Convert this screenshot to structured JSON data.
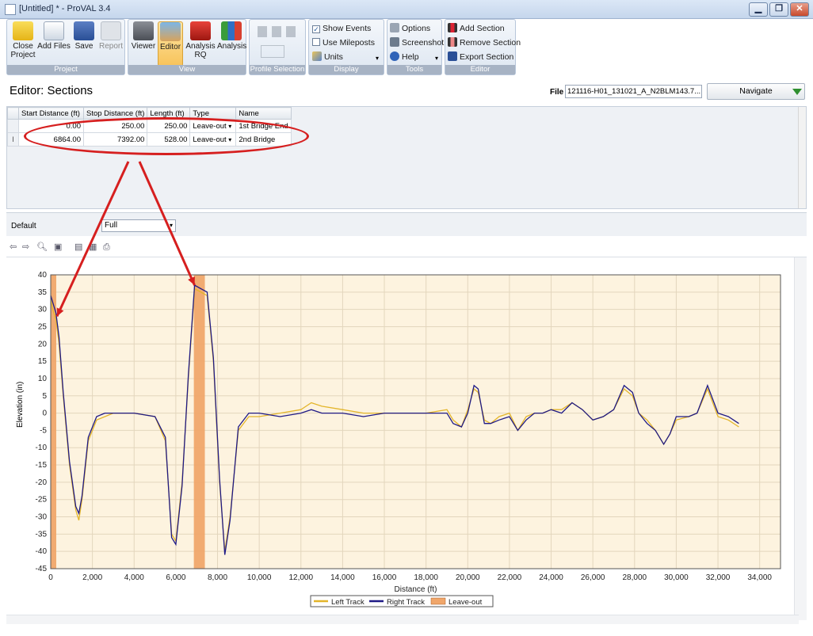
{
  "window": {
    "title": "[Untitled] * - ProVAL 3.4",
    "buttons": [
      "▁",
      "❐",
      "✕"
    ]
  },
  "ribbon": {
    "groups": {
      "project": "Project",
      "view": "View",
      "profile_selection": "Profile Selection",
      "display": "Display",
      "tools": "Tools",
      "editor": "Editor"
    },
    "buttons": {
      "close_project": "Close Project",
      "add_files": "Add Files",
      "save": "Save",
      "report": "Report",
      "viewer": "Viewer",
      "editor": "Editor",
      "analysis_rq": "Analysis RQ",
      "analysis": "Analysis"
    },
    "display": {
      "show_events": "Show Events",
      "use_mileposts": "Use Mileposts",
      "units": "Units"
    },
    "tools": {
      "options": "Options",
      "screenshot": "Screenshot",
      "help": "Help"
    },
    "editor": {
      "add_section": "Add Section",
      "remove_section": "Remove Section",
      "export_section": "Export Section"
    }
  },
  "editor": {
    "title": "Editor: Sections",
    "file_label": "File",
    "file_value": "121116-H01_131021_A_N2BLM143.7...",
    "navigate": "Navigate"
  },
  "sections_table": {
    "columns": [
      "Start Distance (ft)",
      "Stop Distance (ft)",
      "Length (ft)",
      "Type",
      "Name"
    ],
    "rows": [
      {
        "start": "0.00",
        "stop": "250.00",
        "length": "250.00",
        "type": "Leave-out",
        "name": "1st Bridge End"
      },
      {
        "start": "6864.00",
        "stop": "7392.00",
        "length": "528.00",
        "type": "Leave-out",
        "name": "2nd Bridge"
      }
    ],
    "row_marker": "I"
  },
  "view_bar": {
    "default_label": "Default",
    "zoom_value": "Full"
  },
  "colors": {
    "left_track": "#e3b52a",
    "right_track": "#1f1a86",
    "leave_out": "#f0a66a",
    "plot_bg": "#fdf3df",
    "annotation": "#d61f1f"
  },
  "chart_data": {
    "type": "line",
    "xlabel": "Distance (ft)",
    "ylabel": "Elevation (in)",
    "xlim": [
      0,
      35000
    ],
    "ylim": [
      -45,
      40
    ],
    "x_ticks": [
      0,
      2000,
      4000,
      6000,
      8000,
      10000,
      12000,
      14000,
      16000,
      18000,
      20000,
      22000,
      24000,
      26000,
      28000,
      30000,
      32000,
      34000
    ],
    "x_tick_labels": [
      "0",
      "2,000",
      "4,000",
      "6,000",
      "8,000",
      "10,000",
      "12,000",
      "14,000",
      "16,000",
      "18,000",
      "20,000",
      "22,000",
      "24,000",
      "26,000",
      "28,000",
      "30,000",
      "32,000",
      "34,000"
    ],
    "y_ticks": [
      40,
      35,
      30,
      25,
      20,
      15,
      10,
      5,
      0,
      -5,
      -10,
      -15,
      -20,
      -25,
      -30,
      -35,
      -40,
      -45
    ],
    "grid": true,
    "legend_position": "bottom",
    "series": [
      {
        "name": "Left Track",
        "x": [
          0,
          100,
          250,
          400,
          600,
          900,
          1200,
          1350,
          1500,
          1800,
          2200,
          2600,
          3000,
          4000,
          5000,
          5500,
          5800,
          6000,
          6300,
          6600,
          6900,
          7200,
          7500,
          7800,
          8100,
          8350,
          8600,
          9000,
          9500,
          10000,
          11000,
          12000,
          12500,
          13000,
          14000,
          15000,
          16000,
          17000,
          18000,
          19000,
          19300,
          19700,
          20000,
          20300,
          20500,
          20800,
          21100,
          21500,
          22000,
          22400,
          22800,
          23200,
          23600,
          24000,
          24500,
          25000,
          25500,
          26000,
          26500,
          27000,
          27500,
          27900,
          28200,
          28600,
          29000,
          29400,
          29700,
          30000,
          30600,
          31000,
          31500,
          32000,
          32500,
          33000
        ],
        "y": [
          33,
          30,
          27,
          20,
          5,
          -15,
          -28,
          -31,
          -25,
          -8,
          -2,
          -1,
          0,
          0,
          -1,
          -8,
          -35,
          -37,
          -20,
          10,
          36,
          35,
          34,
          15,
          -20,
          -40,
          -30,
          -5,
          -1,
          -1,
          0,
          1,
          3,
          2,
          1,
          0,
          0,
          0,
          0,
          1,
          -2,
          -4,
          1,
          7,
          6,
          -2,
          -3,
          -1,
          0,
          -5,
          -1,
          0,
          0,
          1,
          1,
          3,
          1,
          -2,
          -1,
          1,
          7,
          5,
          0,
          -2,
          -5,
          -9,
          -6,
          -2,
          -1,
          0,
          7,
          -1,
          -2,
          -4
        ]
      },
      {
        "name": "Right Track",
        "x": [
          0,
          100,
          250,
          400,
          600,
          900,
          1200,
          1350,
          1500,
          1800,
          2200,
          2600,
          3000,
          4000,
          5000,
          5500,
          5800,
          6000,
          6300,
          6600,
          6900,
          7200,
          7500,
          7800,
          8100,
          8350,
          8600,
          9000,
          9500,
          10000,
          11000,
          12000,
          12500,
          13000,
          14000,
          15000,
          16000,
          17000,
          18000,
          19000,
          19300,
          19700,
          20000,
          20300,
          20500,
          20800,
          21100,
          21500,
          22000,
          22400,
          22800,
          23200,
          23600,
          24000,
          24500,
          25000,
          25500,
          26000,
          26500,
          27000,
          27500,
          27900,
          28200,
          28600,
          29000,
          29400,
          29700,
          30000,
          30600,
          31000,
          31500,
          32000,
          32500,
          33000
        ],
        "y": [
          34,
          32,
          29,
          22,
          6,
          -14,
          -27,
          -29,
          -24,
          -7,
          -1,
          0,
          0,
          0,
          -1,
          -7,
          -36,
          -38,
          -21,
          11,
          37,
          36,
          35,
          16,
          -19,
          -41,
          -31,
          -4,
          0,
          0,
          -1,
          0,
          1,
          0,
          0,
          -1,
          0,
          0,
          0,
          0,
          -3,
          -4,
          0,
          8,
          7,
          -3,
          -3,
          -2,
          -1,
          -5,
          -2,
          0,
          0,
          1,
          0,
          3,
          1,
          -2,
          -1,
          1,
          8,
          6,
          0,
          -3,
          -5,
          -9,
          -6,
          -1,
          -1,
          0,
          8,
          0,
          -1,
          -3
        ]
      }
    ],
    "shaded_regions": [
      {
        "name": "Leave-out",
        "from": 0,
        "to": 250
      },
      {
        "name": "Leave-out",
        "from": 6864,
        "to": 7392
      }
    ],
    "legend": [
      "Left Track",
      "Right Track",
      "Leave-out"
    ]
  }
}
